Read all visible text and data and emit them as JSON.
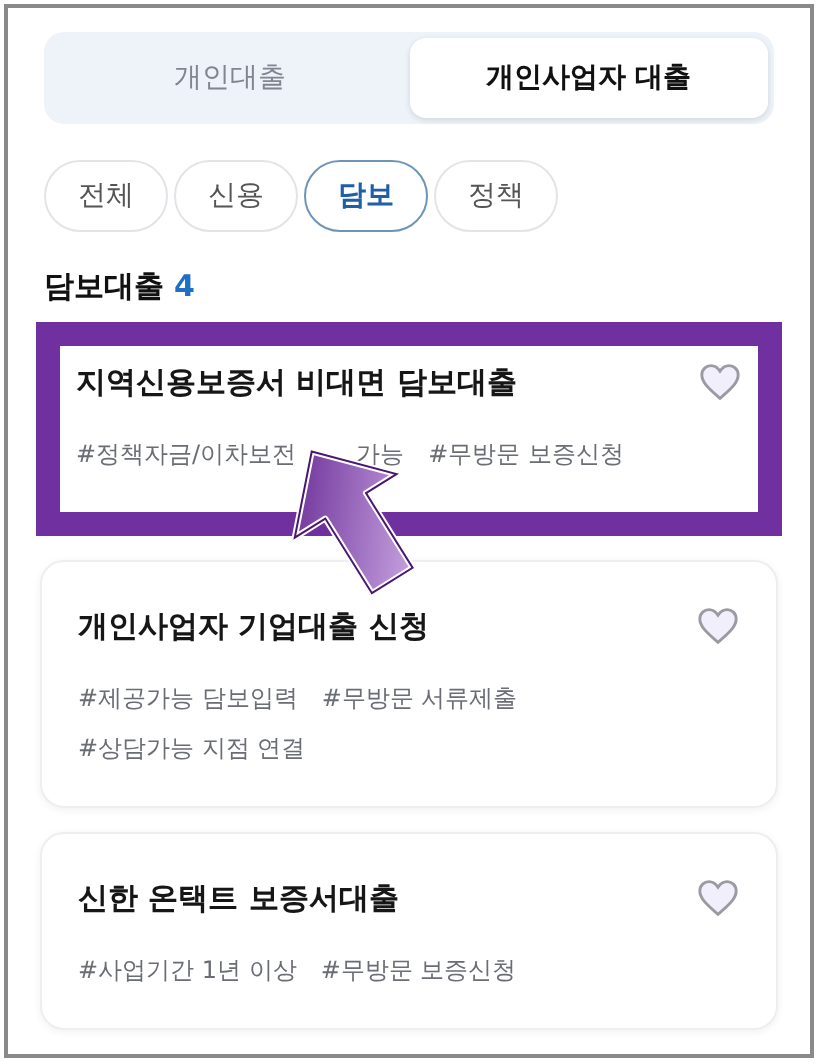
{
  "tabs": [
    {
      "label": "개인대출",
      "selected": false
    },
    {
      "label": "개인사업자 대출",
      "selected": true
    }
  ],
  "filters": [
    {
      "label": "전체",
      "selected": false
    },
    {
      "label": "신용",
      "selected": false
    },
    {
      "label": "담보",
      "selected": true
    },
    {
      "label": "정책",
      "selected": false
    }
  ],
  "section": {
    "title": "담보대출",
    "count": "4"
  },
  "products": [
    {
      "title": "지역신용보증서 비대면 담보대출",
      "highlighted": true,
      "favorite": false,
      "tag_lines": [
        [
          "#정책자금/이차보전",
          "가능",
          "#무방문 보증신청"
        ]
      ]
    },
    {
      "title": "개인사업자 기업대출 신청",
      "highlighted": false,
      "favorite": false,
      "tag_lines": [
        [
          "#제공가능 담보입력",
          "#무방문 서류제출"
        ],
        [
          "#상담가능 지점 연결"
        ]
      ]
    },
    {
      "title": "신한 온택트 보증서대출",
      "highlighted": false,
      "favorite": false,
      "tag_lines": [
        [
          "#사업기간 1년 이상",
          "#무방문 보증신청"
        ]
      ]
    }
  ]
}
